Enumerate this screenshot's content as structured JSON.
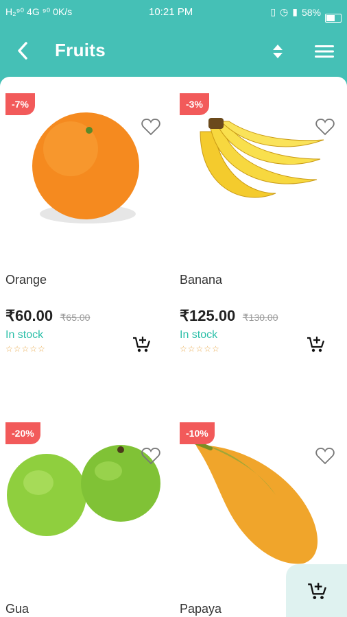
{
  "status_bar": {
    "left": "H₂⁹⁰ 4G ⁹⁰ 0K/s",
    "time": "10:21 PM",
    "battery": "58%"
  },
  "header": {
    "title": "Fruits"
  },
  "products": [
    {
      "name": "Orange",
      "discount": "-7%",
      "price": "₹60.00",
      "old_price": "₹65.00",
      "stock": "In stock",
      "rating": "☆☆☆☆☆"
    },
    {
      "name": "Banana",
      "discount": "-3%",
      "price": "₹125.00",
      "old_price": "₹130.00",
      "stock": "In stock",
      "rating": "☆☆☆☆☆"
    },
    {
      "name": "Gua",
      "discount": "-20%"
    },
    {
      "name": "Papaya",
      "discount": "-10%"
    }
  ],
  "colors": {
    "primary": "#45c0b6",
    "badge": "#f25a5a",
    "stock": "#2bbfa8",
    "star": "#e8a94b",
    "fab_bg": "#dff2f0"
  }
}
